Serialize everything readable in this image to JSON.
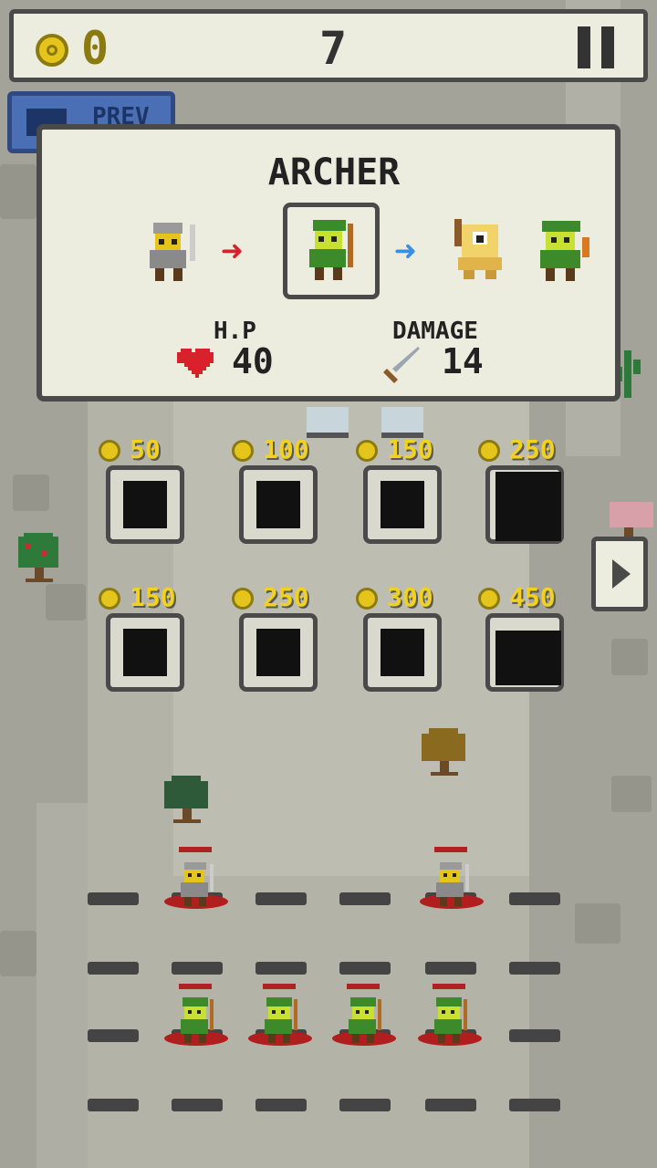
{
  "hud": {
    "coins": "0",
    "wave": "7",
    "icons": {
      "coin": "coin-icon",
      "pause": "pause-icon"
    }
  },
  "prev_button": {
    "label": "PREV",
    "icon": "film-icon"
  },
  "info_panel": {
    "title": "ARCHER",
    "evolution": [
      "soldier",
      "archer",
      "cyclops",
      "elf-archer"
    ],
    "hp_label": "H.P",
    "hp_value": "40",
    "damage_label": "DAMAGE",
    "damage_value": "14"
  },
  "shop": {
    "row1": [
      {
        "price": "50"
      },
      {
        "price": "100"
      },
      {
        "price": "150"
      },
      {
        "price": "250"
      }
    ],
    "row2": [
      {
        "price": "150"
      },
      {
        "price": "250"
      },
      {
        "price": "300"
      },
      {
        "price": "450"
      }
    ]
  },
  "colors": {
    "accent_gold": "#f2d21e",
    "panel_bg": "#ececdf",
    "border": "#4a4a4a",
    "prev_blue": "#4a6fb5",
    "hp_red": "#d8212a",
    "arrow_blue": "#3a8fe0"
  }
}
